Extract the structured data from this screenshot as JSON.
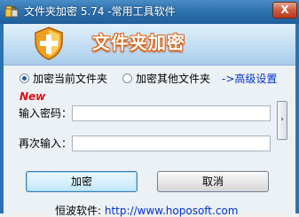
{
  "window": {
    "title": "文件夹加密 5.74 -常用工具软件",
    "close_glyph": "X",
    "frame_color": "#2f72b0"
  },
  "banner": {
    "title": "文件夹加密",
    "icon": "shield-icon"
  },
  "options": {
    "radio_current_folder": "加密当前文件夹",
    "radio_other_folder": "加密其他文件夹",
    "selected": "加密当前文件夹",
    "advanced_link": "->高级设置"
  },
  "form": {
    "new_badge": "New",
    "password_label": "输入密码：",
    "password_value": "",
    "confirm_label": "再次输入：",
    "confirm_value": "",
    "side_handle_glyph": "›"
  },
  "buttons": {
    "encrypt": "加密",
    "cancel": "取消"
  },
  "footer": {
    "label": "恒波软件:",
    "url": "http://www.hoposoft.com"
  }
}
